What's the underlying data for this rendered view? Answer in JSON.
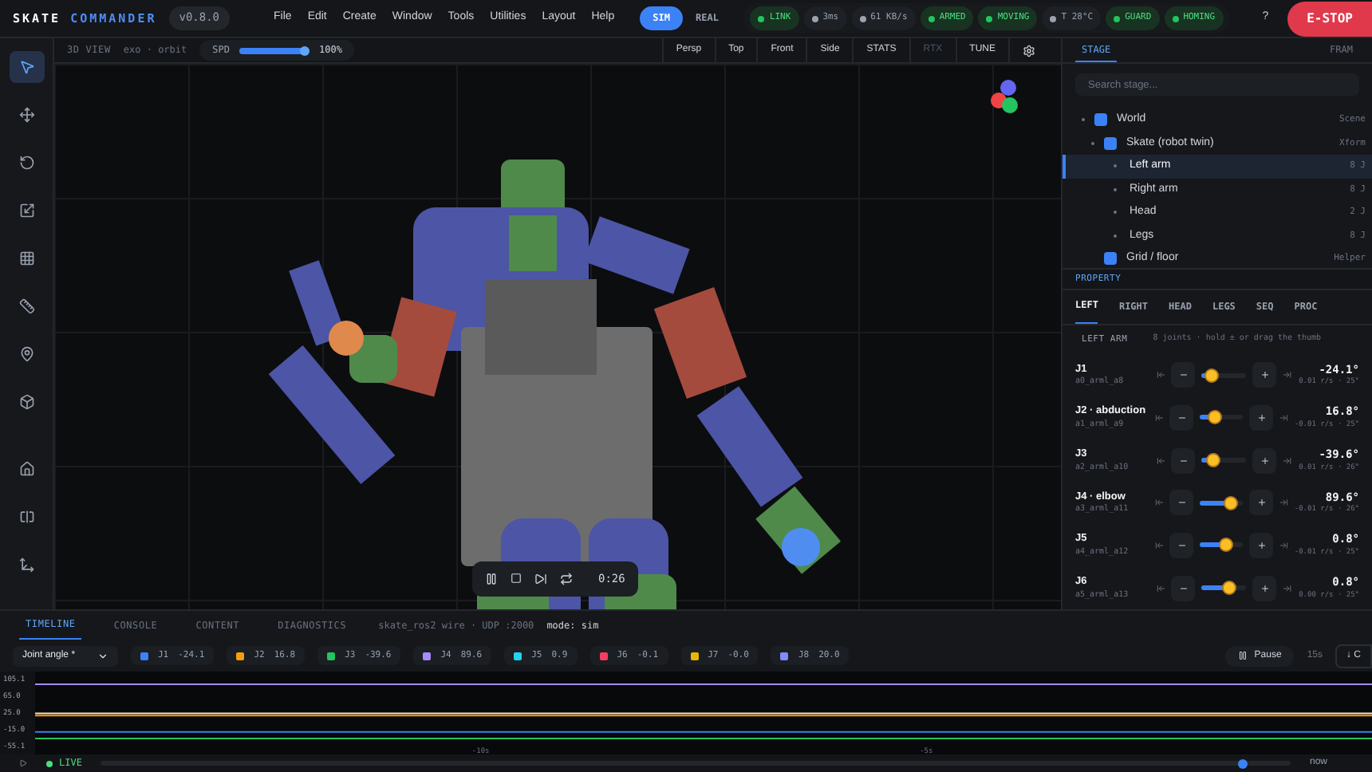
{
  "app": {
    "name_first": "SKATE",
    "name_second": "COMMANDER",
    "version": "v0.8.0"
  },
  "menu": [
    "File",
    "Edit",
    "Create",
    "Window",
    "Tools",
    "Utilities",
    "Layout",
    "Help"
  ],
  "mode_toggle": [
    {
      "label": "SIM",
      "selected": true
    },
    {
      "label": "REAL",
      "selected": false
    }
  ],
  "status_pills": [
    {
      "label": "LINK",
      "color": "#22c55e",
      "alert": true
    },
    {
      "label": "3ms",
      "color": "#9ca3af",
      "alert": false
    },
    {
      "label": "61 KB/s",
      "color": "#9ca3af",
      "alert": false
    },
    {
      "label": "ARMED",
      "color": "#22c55e",
      "alert": true
    },
    {
      "label": "MOVING",
      "color": "#22c55e",
      "alert": true
    },
    {
      "label": "T 28°C",
      "color": "#9ca3af",
      "alert": false
    },
    {
      "label": "GUARD",
      "color": "#22c55e",
      "alert": true
    },
    {
      "label": "HOMING",
      "color": "#22c55e",
      "alert": true
    }
  ],
  "help_button": "?",
  "estop": "E-STOP",
  "tools": [
    {
      "kind": "select",
      "selected": true
    },
    {
      "kind": "move",
      "selected": false
    },
    {
      "kind": "rotate",
      "selected": false
    },
    {
      "kind": "scale",
      "selected": false
    },
    {
      "kind": "grid",
      "selected": false
    },
    {
      "kind": "ruler",
      "selected": false
    },
    {
      "kind": "pin",
      "selected": false
    },
    {
      "kind": "box",
      "selected": false
    },
    {
      "kind": "home",
      "selected": false
    },
    {
      "kind": "split",
      "selected": false
    },
    {
      "kind": "expand",
      "selected": false
    }
  ],
  "viewport": {
    "title": "3D VIEW",
    "subtitle": "exo · orbit",
    "speed": {
      "label": "SPD",
      "level": 0.93,
      "reading": "100%"
    },
    "view_buttons": [
      {
        "label": "Persp",
        "disabled": false
      },
      {
        "label": "Top",
        "disabled": false
      },
      {
        "label": "Front",
        "disabled": false
      },
      {
        "label": "Side",
        "disabled": false
      },
      {
        "label": "STATS",
        "disabled": false
      },
      {
        "label": "RTX",
        "disabled": true
      },
      {
        "label": "TUNE",
        "disabled": false
      }
    ],
    "playback": {
      "time": "0:26"
    }
  },
  "stage": {
    "tabs": [
      {
        "label": "STAGE",
        "selected": true
      },
      {
        "label": "FRAM",
        "selected": false
      }
    ],
    "search": {
      "placeholder": "Search stage..."
    },
    "tree": [
      {
        "name": "World",
        "type": "Scene",
        "kind": "group",
        "selected": false,
        "children": [
          {
            "name": "Skate (robot twin)",
            "type": "Xform",
            "kind": "group",
            "selected": false,
            "children": [
              {
                "name": "Left arm",
                "type": "8 J",
                "kind": "part",
                "selected": true
              },
              {
                "name": "Right arm",
                "type": "8 J",
                "kind": "part",
                "selected": false
              },
              {
                "name": "Head",
                "type": "2 J",
                "kind": "part",
                "selected": false
              },
              {
                "name": "Legs",
                "type": "8 J",
                "kind": "part",
                "selected": false
              }
            ]
          },
          {
            "name": "Grid / floor",
            "type": "Helper",
            "kind": "group",
            "selected": false
          }
        ]
      }
    ]
  },
  "property": {
    "header": "PROPERTY",
    "tabs": [
      {
        "label": "LEFT",
        "selected": true
      },
      {
        "label": "RIGHT",
        "selected": false
      },
      {
        "label": "HEAD",
        "selected": false
      },
      {
        "label": "LEGS",
        "selected": false
      },
      {
        "label": "SEQ",
        "selected": false
      },
      {
        "label": "PROC",
        "selected": false
      }
    ],
    "section": {
      "title": "LEFT ARM",
      "hint": "8 joints · hold ± or drag the thumb"
    },
    "joints": [
      {
        "name": "J1",
        "id": "a0_arml_a8",
        "level": 0.2,
        "value": "-24.1°",
        "rate": "0.01 r/s · 25°"
      },
      {
        "name": "J2 · abduction",
        "id": "a1_arml_a9",
        "level": 0.35,
        "value": "16.8°",
        "rate": "-0.01 r/s · 25°"
      },
      {
        "name": "J3",
        "id": "a2_arml_a10",
        "level": 0.22,
        "value": "-39.6°",
        "rate": "0.01 r/s · 26°"
      },
      {
        "name": "J4 · elbow",
        "id": "a3_arml_a11",
        "level": 0.7,
        "value": "89.6°",
        "rate": "-0.01 r/s · 26°"
      },
      {
        "name": "J5",
        "id": "a4_arml_a12",
        "level": 0.6,
        "value": "0.8°",
        "rate": "-0.01 r/s · 25°"
      },
      {
        "name": "J6",
        "id": "a5_arml_a13",
        "level": 0.6,
        "value": "0.8°",
        "rate": "0.00 r/s · 25°"
      }
    ]
  },
  "bottom": {
    "tabs": [
      {
        "label": "TIMELINE",
        "selected": true
      },
      {
        "label": "CONSOLE",
        "selected": false
      },
      {
        "label": "CONTENT",
        "selected": false
      },
      {
        "label": "DIAGNOSTICS",
        "selected": false
      }
    ],
    "wire": "skate_ros2 wire · UDP :2000",
    "mode": "mode: sim",
    "signal_select": "Joint angle *",
    "legend": [
      {
        "label": "J1",
        "value": "-24.1",
        "color": "#3b82f6"
      },
      {
        "label": "J2",
        "value": "16.8",
        "color": "#f59e0b"
      },
      {
        "label": "J3",
        "value": "-39.6",
        "color": "#22c55e"
      },
      {
        "label": "J4",
        "value": "89.6",
        "color": "#a78bfa"
      },
      {
        "label": "J5",
        "value": "0.9",
        "color": "#22d3ee"
      },
      {
        "label": "J6",
        "value": "-0.1",
        "color": "#f43f5e"
      },
      {
        "label": "J7",
        "value": "-0.0",
        "color": "#eab308"
      },
      {
        "label": "J8",
        "value": "20.0",
        "color": "#818cf8"
      }
    ],
    "pause": "Pause",
    "window": "15s",
    "export": "↓ C",
    "chart_data": {
      "type": "line",
      "x": [
        -15,
        0
      ],
      "xlim": [
        -15,
        0
      ],
      "ylim": [
        -55.1,
        105.1
      ],
      "xticks": [
        {
          "value": -10,
          "label": "-10s"
        },
        {
          "value": -5,
          "label": "-5s"
        }
      ],
      "yticks": [
        {
          "value": 105.1,
          "label": "105.1"
        },
        {
          "value": 65,
          "label": "65.0"
        },
        {
          "value": 25,
          "label": "25.0"
        },
        {
          "value": -15,
          "label": "-15.0"
        },
        {
          "value": -55.1,
          "label": "-55.1"
        }
      ],
      "series": [
        {
          "color": "#a78bfa",
          "values": [
            90,
            90
          ]
        },
        {
          "color": "#fde2c4",
          "values": [
            20,
            20
          ]
        },
        {
          "color": "#f59e0b",
          "values": [
            15,
            15
          ]
        },
        {
          "color": "#3b82f6",
          "values": [
            -24,
            -24
          ]
        },
        {
          "color": "#22c55e",
          "values": [
            -40,
            -40
          ]
        }
      ]
    },
    "live": "LIVE",
    "scrub": {
      "level": 0.96
    },
    "now": "now"
  }
}
